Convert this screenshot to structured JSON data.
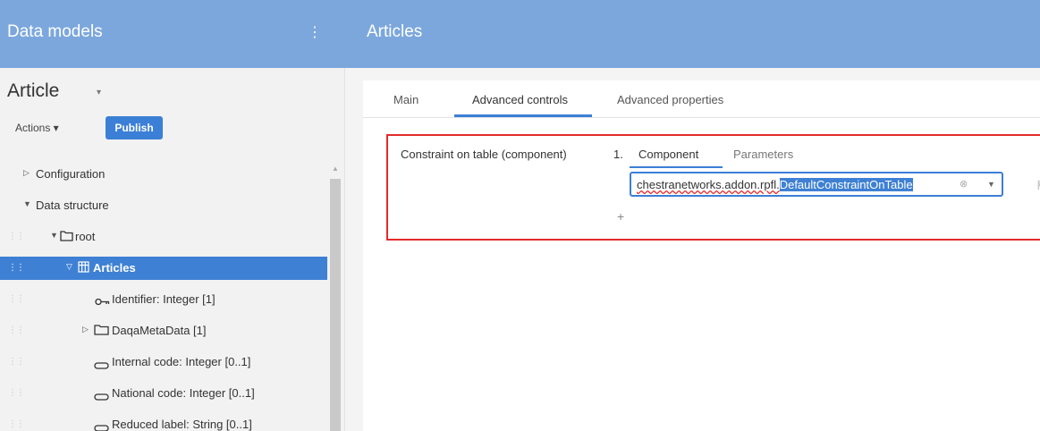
{
  "header": {
    "left_title": "Data models",
    "kebab": "⋮",
    "right_title": "Articles"
  },
  "sidebar": {
    "model_title": "Article",
    "model_caret": "▾",
    "actions_label": "Actions ▾",
    "publish_label": "Publish",
    "tree": [
      {
        "label": "Configuration",
        "toggle": "▷",
        "icon": "",
        "selected": false
      },
      {
        "label": "Data structure",
        "toggle": "▼",
        "icon": "",
        "selected": false
      },
      {
        "label": "root",
        "toggle": "▼",
        "icon": "folder",
        "selected": false
      },
      {
        "label": "Articles",
        "toggle": "▽",
        "icon": "table",
        "selected": true
      },
      {
        "label": "Identifier: Integer  [1]",
        "toggle": "",
        "icon": "key",
        "selected": false
      },
      {
        "label": "DaqaMetaData [1]",
        "toggle": "▷",
        "icon": "folder",
        "selected": false
      },
      {
        "label": "Internal code: Integer  [0..1]",
        "toggle": "",
        "icon": "field",
        "selected": false
      },
      {
        "label": "National code: Integer  [0..1]",
        "toggle": "",
        "icon": "field",
        "selected": false
      },
      {
        "label": "Reduced label: String  [0..1]",
        "toggle": "",
        "icon": "field",
        "selected": false
      }
    ]
  },
  "main": {
    "tabs": [
      {
        "label": "Main",
        "active": false
      },
      {
        "label": "Advanced controls",
        "active": true
      },
      {
        "label": "Advanced properties",
        "active": false
      }
    ],
    "constraint": {
      "label": "Constraint on table (component)",
      "index": "1.",
      "subtabs": [
        {
          "label": "Component",
          "active": true
        },
        {
          "label": "Parameters",
          "active": false
        }
      ],
      "value_prefix": "chestranetworks.addon.rpfl.",
      "value_selected": "DefaultConstraintOnTable",
      "clear_glyph": "⊗",
      "dropdown_glyph": "▼",
      "external_glyph": "⇱",
      "add_glyph": "+"
    }
  },
  "colors": {
    "header_bg": "#7ba7dc",
    "accent": "#3c7fd6",
    "selection": "#3e80d4",
    "highlight_border": "#e32a2a"
  }
}
